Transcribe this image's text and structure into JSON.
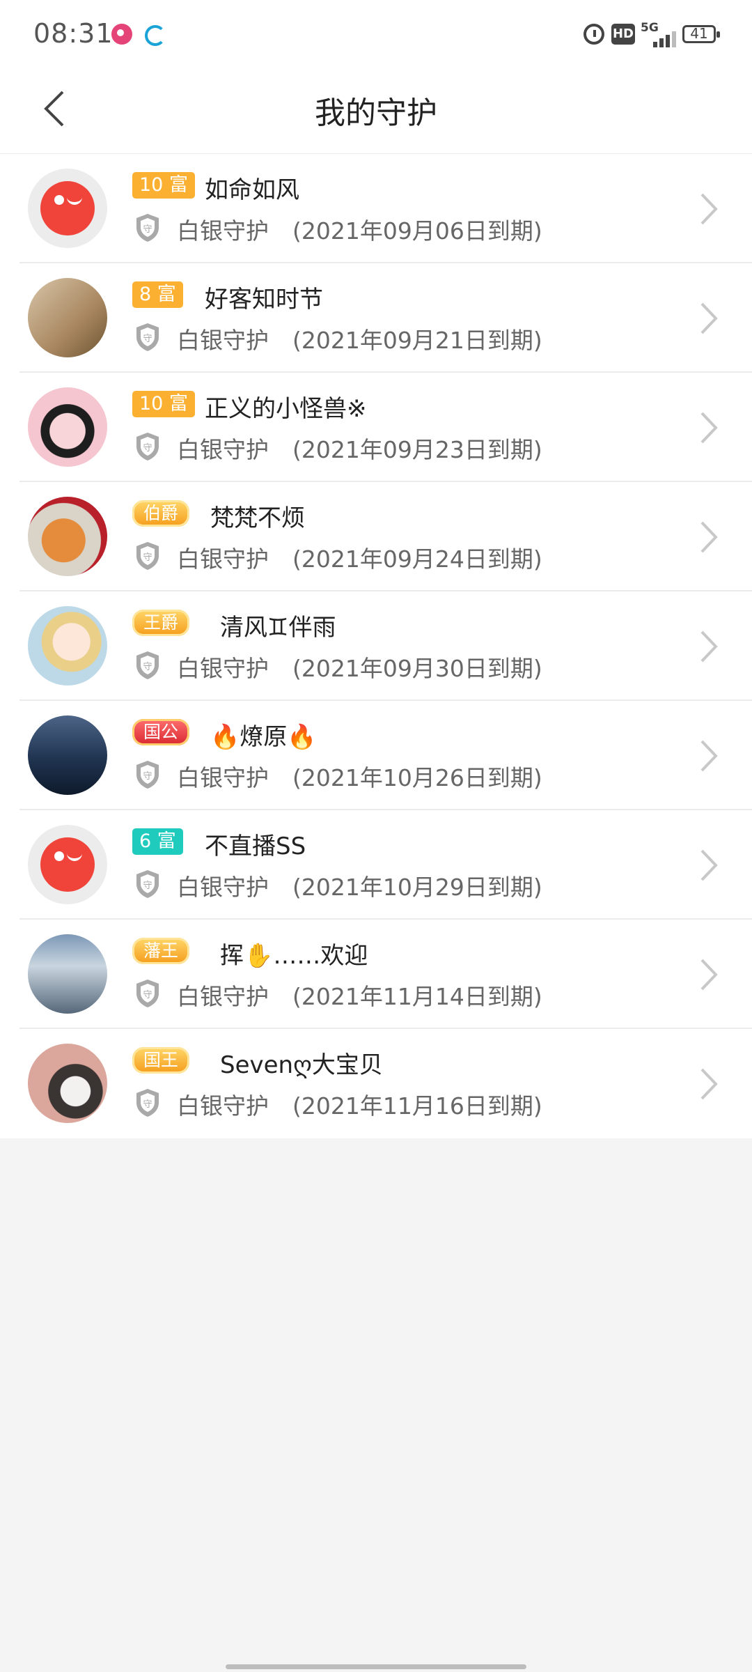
{
  "status_bar": {
    "time": "08:31",
    "network": "5G",
    "battery": "41",
    "icons": [
      "alarm-icon",
      "hd-icon",
      "signal-icon",
      "battery-icon"
    ]
  },
  "header": {
    "title": "我的守护",
    "back_icon": "chevron-left-icon"
  },
  "colors": {
    "badge_orange": "#fbb031",
    "badge_teal": "#1fcbbd",
    "text_secondary": "#666666",
    "page_bg": "#f4f4f4"
  },
  "guard_list": [
    {
      "badge": "10 富",
      "name": "如命如风",
      "guard_type": "白银守护",
      "expiry": "(2021年09月06日到期)"
    },
    {
      "badge": "8 富",
      "name": "好客知时节",
      "guard_type": "白银守护",
      "expiry": "(2021年09月21日到期)"
    },
    {
      "badge": "10 富",
      "name": "正义的小怪兽※",
      "guard_type": "白银守护",
      "expiry": "(2021年09月23日到期)"
    },
    {
      "badge": "伯爵",
      "name": "梵梵不烦",
      "guard_type": "白银守护",
      "expiry": "(2021年09月24日到期)"
    },
    {
      "badge": "王爵",
      "name": "清风♊伴雨",
      "guard_type": "白银守护",
      "expiry": "(2021年09月30日到期)"
    },
    {
      "badge": "国公",
      "name": "🔥燎原🔥",
      "guard_type": "白银守护",
      "expiry": "(2021年10月26日到期)"
    },
    {
      "badge": "6 富",
      "name": "不直播SS",
      "guard_type": "白银守护",
      "expiry": "(2021年10月29日到期)"
    },
    {
      "badge": "藩王",
      "name": "挥✋……欢迎",
      "guard_type": "白银守护",
      "expiry": "(2021年11月14日到期)"
    },
    {
      "badge": "国王",
      "name": "Sevenღ大宝贝",
      "guard_type": "白银守护",
      "expiry": "(2021年11月16日到期)"
    }
  ]
}
